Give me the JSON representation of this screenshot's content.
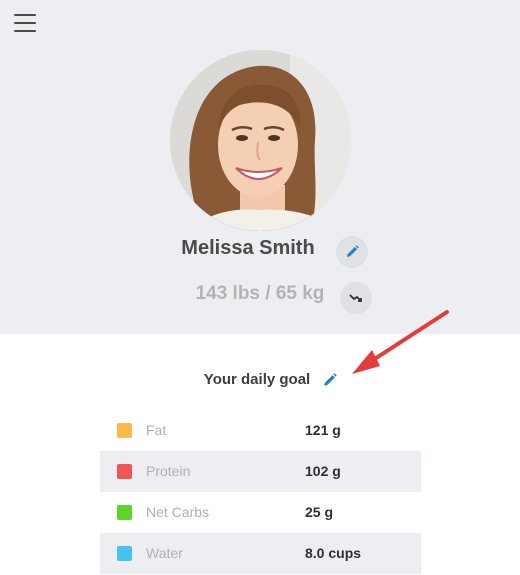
{
  "profile": {
    "name": "Melissa Smith",
    "weight": "143 lbs / 65 kg"
  },
  "icons": {
    "menu": "menu-icon",
    "edit_name": "pencil-icon",
    "weight_trend": "trend-down-icon",
    "goal_edit": "pencil-icon"
  },
  "goal": {
    "title": "Your daily goal"
  },
  "macros": [
    {
      "label": "Fat",
      "value": "121 g",
      "color": "#f7bb4d"
    },
    {
      "label": "Protein",
      "value": "102 g",
      "color": "#f25555"
    },
    {
      "label": "Net Carbs",
      "value": "25 g",
      "color": "#5fd32a"
    },
    {
      "label": "Water",
      "value": "8.0 cups",
      "color": "#45c4f2"
    }
  ],
  "colors": {
    "header_bg": "#eceef1",
    "accent": "#1f7fd3",
    "annotation_arrow": "#e53b3b"
  }
}
